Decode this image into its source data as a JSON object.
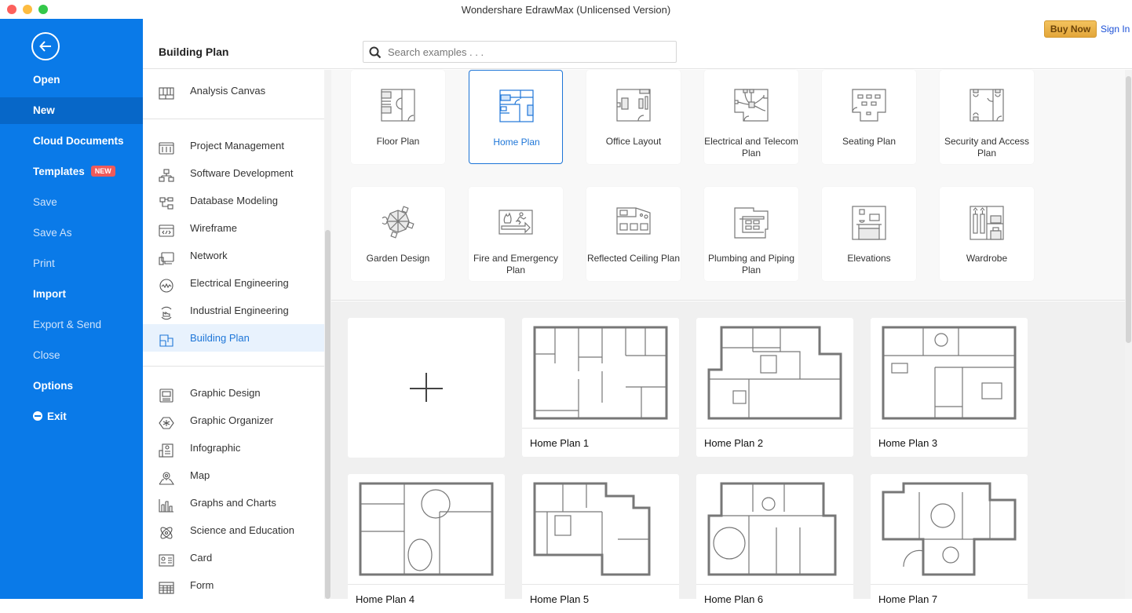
{
  "window": {
    "title": "Wondershare EdrawMax (Unlicensed Version)"
  },
  "header": {
    "buy_now": "Buy Now",
    "sign_in": "Sign In",
    "category_title": "Building Plan",
    "search_placeholder": "Search examples . . .",
    "search_value": ""
  },
  "nav": {
    "items": [
      {
        "label": "Open",
        "style": "bold"
      },
      {
        "label": "New",
        "style": "active"
      },
      {
        "label": "Cloud Documents",
        "style": "bold"
      },
      {
        "label": "Templates",
        "style": "bold",
        "badge": "NEW"
      },
      {
        "label": "Save",
        "style": "dim"
      },
      {
        "label": "Save As",
        "style": "dim"
      },
      {
        "label": "Print",
        "style": "dim"
      },
      {
        "label": "Import",
        "style": "bold"
      },
      {
        "label": "Export & Send",
        "style": "dim"
      },
      {
        "label": "Close",
        "style": "dim"
      },
      {
        "label": "Options",
        "style": "bold"
      },
      {
        "label": "Exit",
        "style": "bold",
        "icon": "minus-circle-icon"
      }
    ]
  },
  "categories": {
    "pinned": [
      {
        "label": "Analysis Canvas",
        "icon": "analysis-canvas-icon"
      }
    ],
    "group1": [
      {
        "label": "Project Management",
        "icon": "project-management-icon"
      },
      {
        "label": "Software Development",
        "icon": "software-development-icon"
      },
      {
        "label": "Database Modeling",
        "icon": "database-modeling-icon"
      },
      {
        "label": "Wireframe",
        "icon": "wireframe-icon"
      },
      {
        "label": "Network",
        "icon": "network-icon"
      },
      {
        "label": "Electrical Engineering",
        "icon": "electrical-engineering-icon"
      },
      {
        "label": "Industrial Engineering",
        "icon": "industrial-engineering-icon"
      },
      {
        "label": "Building Plan",
        "icon": "building-plan-icon",
        "active": true
      }
    ],
    "group2": [
      {
        "label": "Graphic Design",
        "icon": "graphic-design-icon"
      },
      {
        "label": "Graphic Organizer",
        "icon": "graphic-organizer-icon"
      },
      {
        "label": "Infographic",
        "icon": "infographic-icon"
      },
      {
        "label": "Map",
        "icon": "map-pin-icon"
      },
      {
        "label": "Graphs and Charts",
        "icon": "bar-chart-icon"
      },
      {
        "label": "Science and Education",
        "icon": "atom-icon"
      },
      {
        "label": "Card",
        "icon": "card-icon"
      },
      {
        "label": "Form",
        "icon": "form-table-icon"
      }
    ]
  },
  "types": [
    {
      "label": "Floor Plan",
      "icon": "floor-plan-icon"
    },
    {
      "label": "Home Plan",
      "icon": "home-plan-icon",
      "active": true
    },
    {
      "label": "Office Layout",
      "icon": "office-layout-icon"
    },
    {
      "label": "Electrical and Telecom Plan",
      "icon": "electrical-telecom-icon"
    },
    {
      "label": "Seating Plan",
      "icon": "seating-plan-icon"
    },
    {
      "label": "Security and Access Plan",
      "icon": "security-access-icon"
    },
    {
      "label": "Garden Design",
      "icon": "garden-design-icon"
    },
    {
      "label": "Fire and Emergency Plan",
      "icon": "fire-emergency-icon"
    },
    {
      "label": "Reflected Ceiling Plan",
      "icon": "reflected-ceiling-icon"
    },
    {
      "label": "Plumbing and Piping Plan",
      "icon": "plumbing-piping-icon"
    },
    {
      "label": "Elevations",
      "icon": "elevations-icon"
    },
    {
      "label": "Wardrobe",
      "icon": "wardrobe-icon"
    }
  ],
  "examples": [
    {
      "label": "Home Plan 1"
    },
    {
      "label": "Home Plan 2"
    },
    {
      "label": "Home Plan 3"
    },
    {
      "label": "Home Plan 4"
    },
    {
      "label": "Home Plan 5"
    },
    {
      "label": "Home Plan 6"
    },
    {
      "label": "Home Plan 7"
    }
  ],
  "colors": {
    "nav_bg": "#0a7ae8",
    "accent": "#1e76d8",
    "badge": "#ef5a5a",
    "buy_now": "#e8b04a"
  }
}
